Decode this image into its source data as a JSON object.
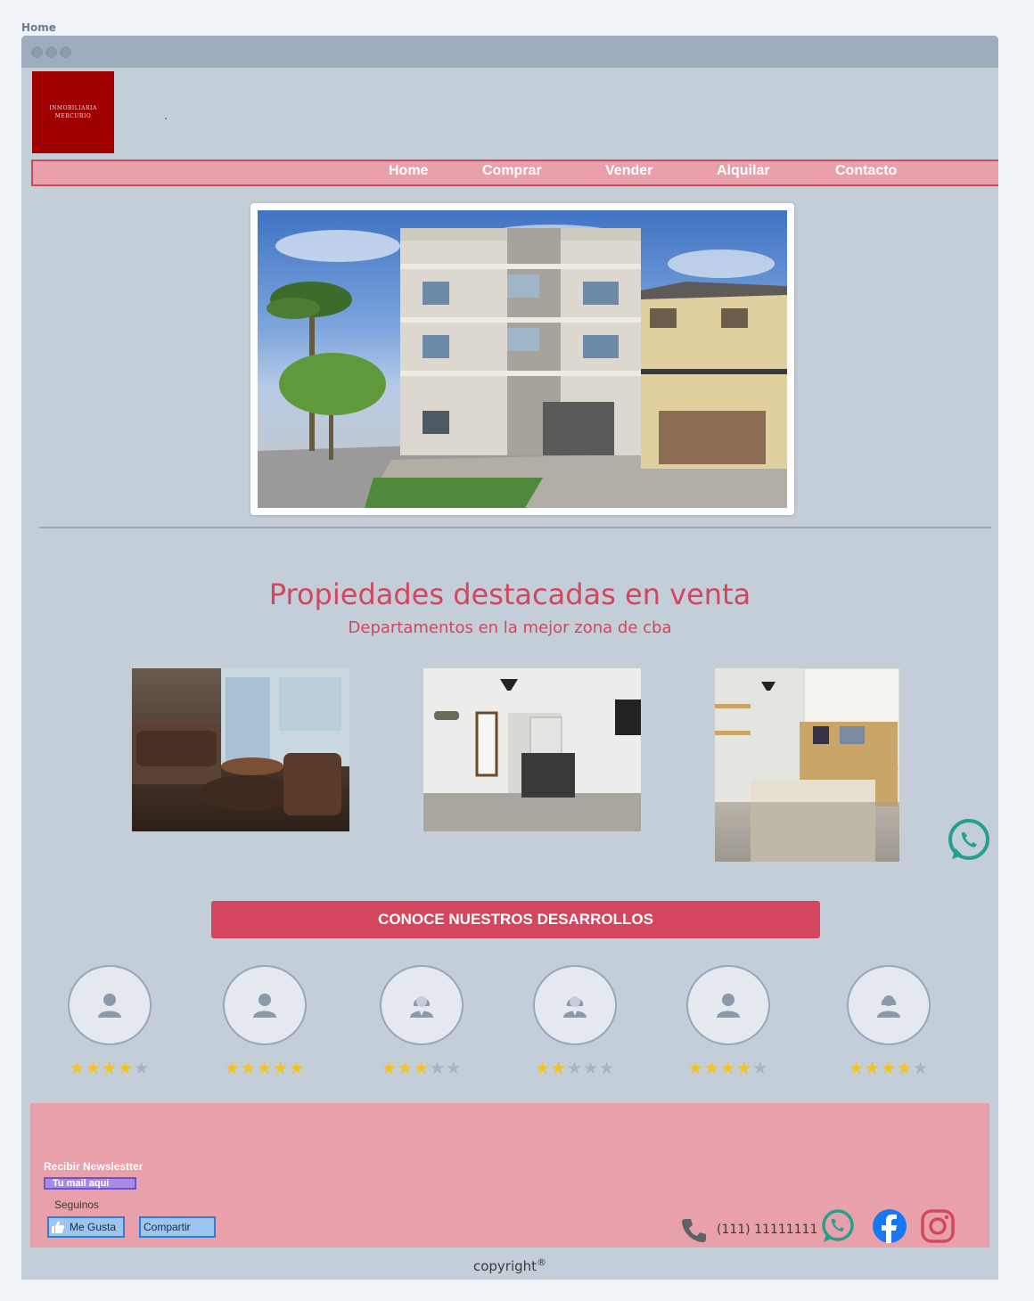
{
  "breadcrumb": "Home",
  "logo": {
    "line1": "INMOBILIARIA",
    "line2": "MERCURIO",
    "bg_color": "#a10000"
  },
  "nav": {
    "items": [
      {
        "label": "Home"
      },
      {
        "label": "Comprar"
      },
      {
        "label": "Vender"
      },
      {
        "label": "Alquilar"
      },
      {
        "label": "Contacto"
      }
    ]
  },
  "hero": {
    "icon": "building-photo"
  },
  "section": {
    "title": "Propiedades destacadas en venta",
    "subtitle": "Departamentos en la mejor zona de cba"
  },
  "properties": [
    {
      "icon": "living-room-photo"
    },
    {
      "icon": "kitchen-photo"
    },
    {
      "icon": "bedroom-photo"
    }
  ],
  "cta": {
    "label": "CONOCE NUESTROS DESARROLLOS"
  },
  "agents": [
    {
      "icon": "user-icon",
      "rating": 4
    },
    {
      "icon": "user-icon",
      "rating": 5
    },
    {
      "icon": "female-agent-icon",
      "rating": 3
    },
    {
      "icon": "female-agent-icon",
      "rating": 2
    },
    {
      "icon": "user-icon",
      "rating": 4
    },
    {
      "icon": "female-user-icon",
      "rating": 4
    }
  ],
  "footer": {
    "newsletter_label": "Recibir Newslestter",
    "newsletter_placeholder": "Tu mail aqui",
    "follow_label": "Seguinos",
    "like_label": "Me Gusta",
    "share_label": "Compartir",
    "phone": "(111) 11111111",
    "bg_color": "#e8a1aa"
  },
  "copyright": "copyright",
  "copyright_mark": "®",
  "colors": {
    "accent": "#d4465d",
    "star": "#f7c21a",
    "whatsapp": "#25a08e",
    "facebook": "#1877f2",
    "instagram": "#d4465d"
  }
}
